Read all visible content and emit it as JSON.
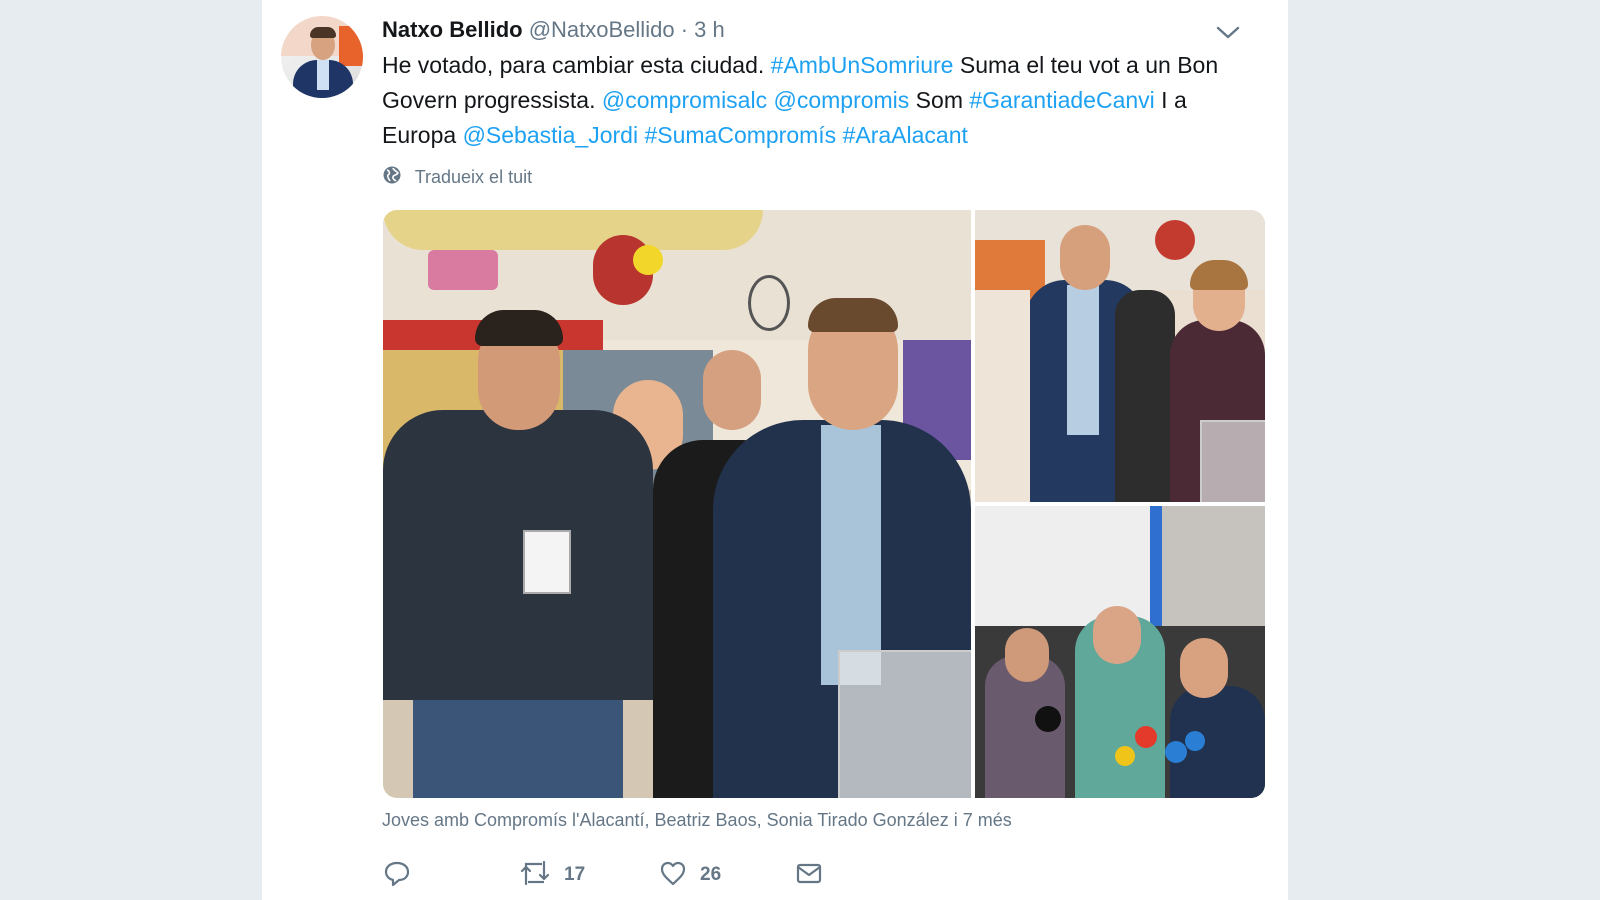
{
  "tweet": {
    "author_name": "Natxo Bellido",
    "author_handle": "@NatxoBellido",
    "separator": "·",
    "time": "3 h",
    "text": [
      {
        "text": "He votado, para cambiar esta ciudad. ",
        "type": "plain"
      },
      {
        "text": "#AmbUnSomriure",
        "type": "hashtag"
      },
      {
        "text": " Suma el teu vot a un Bon Govern progressista. ",
        "type": "plain"
      },
      {
        "text": "@compromisalc",
        "type": "mention"
      },
      {
        "text": " ",
        "type": "plain"
      },
      {
        "text": "@compromis",
        "type": "mention"
      },
      {
        "text": " Som ",
        "type": "plain"
      },
      {
        "text": "#GarantiadeCanvi",
        "type": "hashtag"
      },
      {
        "text": " I a Europa ",
        "type": "plain"
      },
      {
        "text": "@Sebastia_Jordi",
        "type": "mention"
      },
      {
        "text": " ",
        "type": "plain"
      },
      {
        "text": "#SumaCompromís",
        "type": "hashtag"
      },
      {
        "text": " ",
        "type": "plain"
      },
      {
        "text": "#AraAlacant",
        "type": "hashtag"
      }
    ],
    "translate_label": "Tradueix el tuit",
    "tagged_people": "Joves amb Compromís l'Alacantí, Beatriz Baos, Sonia Tirado González i 7 més",
    "retweet_count": "17",
    "like_count": "26",
    "icons": {
      "reply": "reply-icon",
      "retweet": "retweet-icon",
      "like": "heart-icon",
      "dm": "envelope-icon",
      "translate": "globe-icon",
      "menu": "chevron-down-icon"
    }
  },
  "colors": {
    "link": "#1da1f2",
    "secondary_text": "#657786",
    "page_background": "#e6ecf0"
  }
}
